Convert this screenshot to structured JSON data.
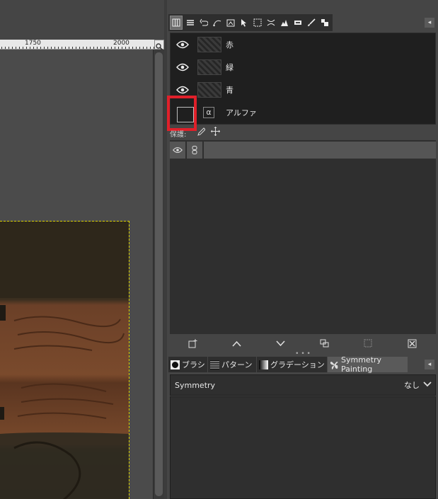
{
  "ruler": {
    "labels": [
      "1750",
      "2000"
    ]
  },
  "dock_tabs": [
    "channels-tab",
    "layers-tab",
    "undo-tab",
    "paths-tab",
    "images-tab",
    "pointer-tab",
    "selection-tab",
    "tool-options-tab",
    "histogram-tab",
    "sample-points-tab",
    "device-status-tab",
    "brushes-tab2"
  ],
  "channels": [
    {
      "name": "赤",
      "visible": true
    },
    {
      "name": "緑",
      "visible": true
    },
    {
      "name": "青",
      "visible": true
    },
    {
      "name": "アルファ",
      "visible": false,
      "selected_box": true
    }
  ],
  "alpha_icon_glyph": "α",
  "lock_label": "保護:",
  "lower_tabs": [
    {
      "label": "ブラシ",
      "icon": "brush-icon"
    },
    {
      "label": "パターン",
      "icon": "pattern-icon"
    },
    {
      "label": "グラデーション",
      "icon": "gradient-icon"
    },
    {
      "label": "Symmetry Painting",
      "icon": "butterfly-icon"
    }
  ],
  "symmetry": {
    "label": "Symmetry",
    "value": "なし"
  },
  "colors": {
    "highlight": "#e0202a",
    "selection_border": "#d8d000"
  }
}
